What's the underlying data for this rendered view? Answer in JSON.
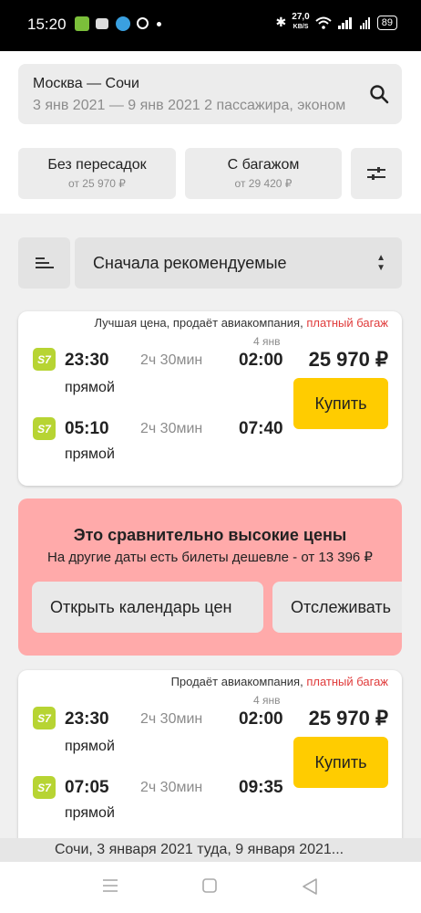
{
  "status_bar": {
    "time": "15:20",
    "net_speed_value": "27,0",
    "net_speed_unit": "KB/S",
    "battery": "89"
  },
  "search": {
    "route": "Москва — Сочи",
    "details": "3 янв 2021 — 9 янв 2021   2 пассажира, эконом"
  },
  "filters": [
    {
      "title": "Без пересадок",
      "price": "от 25 970 ₽"
    },
    {
      "title": "С багажом",
      "price": "от 29 420 ₽"
    }
  ],
  "sort": {
    "label": "Сначала рекомендуемые"
  },
  "offers": [
    {
      "header_text": "Лучшая цена, продаёт авиакомпания, ",
      "header_warning": "платный багаж",
      "return_date": "4 янв",
      "price": "25 970 ₽",
      "buy_label": "Купить",
      "airline_logo": "S7",
      "outbound": {
        "depart": "23:30",
        "duration": "2ч 30мин",
        "arrive": "02:00",
        "stops": "прямой"
      },
      "inbound": {
        "depart": "05:10",
        "duration": "2ч 30мин",
        "arrive": "07:40",
        "stops": "прямой"
      }
    },
    {
      "header_text": "Продаёт авиакомпания, ",
      "header_warning": "платный багаж",
      "return_date": "4 янв",
      "price": "25 970 ₽",
      "buy_label": "Купить",
      "airline_logo": "S7",
      "outbound": {
        "depart": "23:30",
        "duration": "2ч 30мин",
        "arrive": "02:00",
        "stops": "прямой"
      },
      "inbound": {
        "depart": "07:05",
        "duration": "2ч 30мин",
        "arrive": "09:35",
        "stops": "прямой"
      }
    }
  ],
  "price_alert": {
    "title": "Это сравнительно высокие цены",
    "message": "На другие даты есть билеты дешевле - от 13 396 ₽",
    "calendar_button": "Открыть календарь цен",
    "track_button": "Отслеживать"
  },
  "footer": {
    "text": "Сочи, 3 января 2021 туда, 9 января 2021..."
  },
  "colors": {
    "accent": "#ffcc00",
    "alert_bg": "#ffaaaa",
    "warning_text": "#e03b3b",
    "s7_logo": "#b7d433"
  }
}
